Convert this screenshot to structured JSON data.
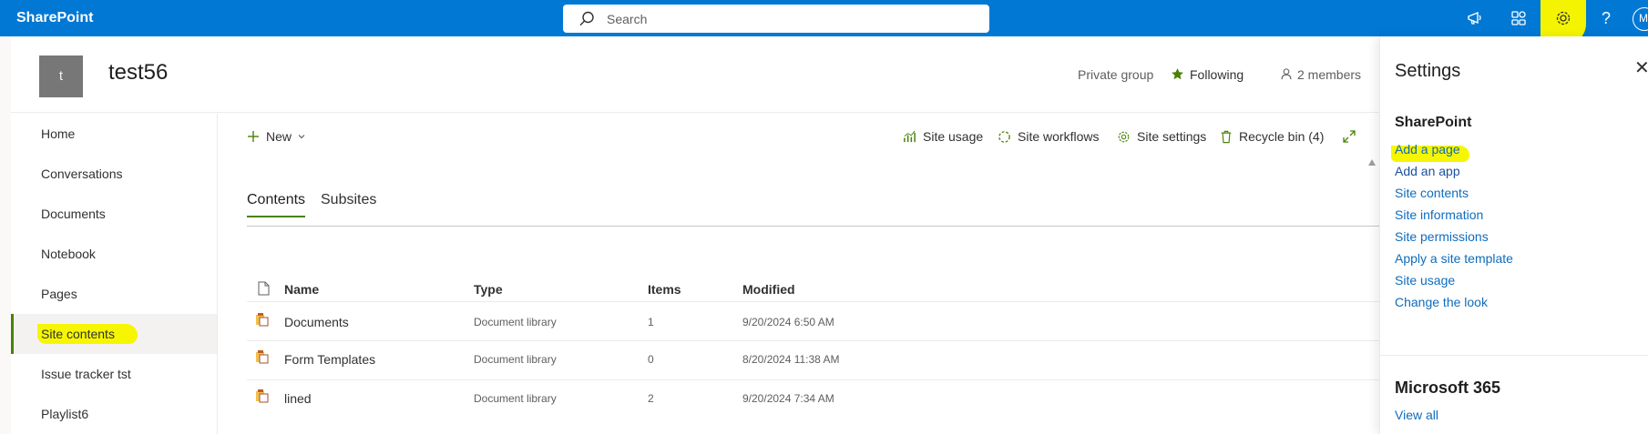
{
  "topbar": {
    "brand": "SharePoint",
    "search_placeholder": "Search",
    "icons": [
      "megaphone-icon",
      "connections-icon",
      "gear-icon",
      "help-icon"
    ],
    "avatar_initial": "M",
    "highlight_color": "#f4f400"
  },
  "site": {
    "logo_letter": "t",
    "title": "test56",
    "privacy": "Private group",
    "following": "Following",
    "members": "2 members"
  },
  "nav": {
    "items": [
      "Home",
      "Conversations",
      "Documents",
      "Notebook",
      "Pages",
      "Site contents",
      "Issue tracker tst",
      "Playlist6"
    ],
    "active": "Site contents"
  },
  "commands": {
    "new": "New",
    "site_usage": "Site usage",
    "site_workflows": "Site workflows",
    "site_settings": "Site settings",
    "recycle_bin": "Recycle bin (4)"
  },
  "tabs": [
    "Contents",
    "Subsites"
  ],
  "table": {
    "headers": [
      "Name",
      "Type",
      "Items",
      "Modified"
    ],
    "rows": [
      {
        "name": "Documents",
        "type": "Document library",
        "items": "1",
        "modified": "9/20/2024 6:50 AM"
      },
      {
        "name": "Form Templates",
        "type": "Document library",
        "items": "0",
        "modified": "8/20/2024 11:38 AM"
      },
      {
        "name": "lined",
        "type": "Document library",
        "items": "2",
        "modified": "9/20/2024 7:34 AM"
      }
    ]
  },
  "settings_panel": {
    "title": "Settings",
    "section": "SharePoint",
    "links": [
      "Add a page",
      "Add an app",
      "Site contents",
      "Site information",
      "Site permissions",
      "Apply a site template",
      "Site usage",
      "Change the look"
    ],
    "section2": "Microsoft 365",
    "view_all": "View all"
  },
  "colors": {
    "suite_bar": "#0078d4",
    "accent_green": "#498205",
    "link_blue": "#0f6cbd"
  }
}
